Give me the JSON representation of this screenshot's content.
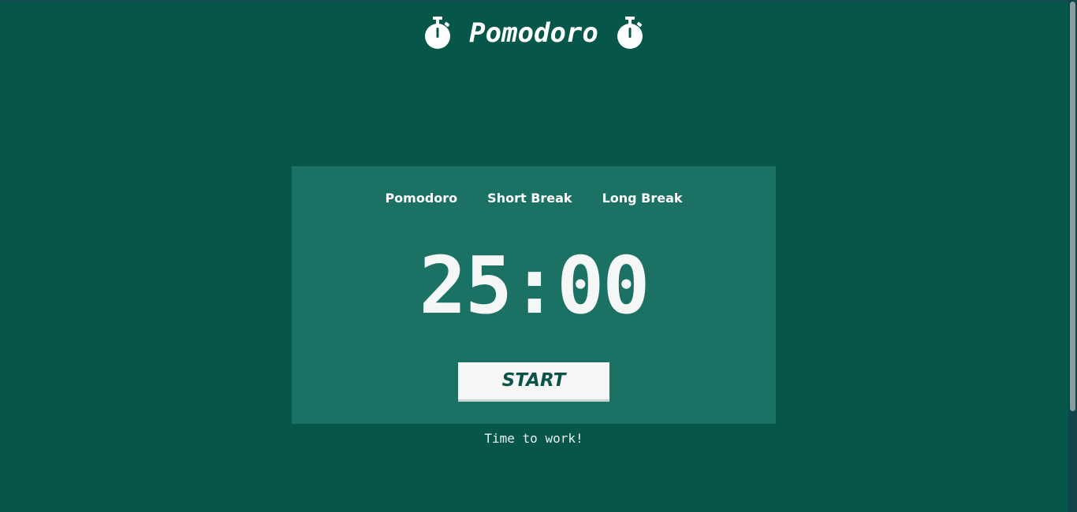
{
  "header": {
    "title": "Pomodoro",
    "left_icon": "stopwatch-icon",
    "right_icon": "stopwatch-icon"
  },
  "modes": [
    {
      "label": "Pomodoro"
    },
    {
      "label": "Short Break"
    },
    {
      "label": "Long Break"
    }
  ],
  "timer": {
    "display": "25:00"
  },
  "controls": {
    "start_label": "START"
  },
  "status": {
    "message": "Time to work!"
  },
  "colors": {
    "background": "#06564a",
    "panel": "#1b7163",
    "text": "#ffffff",
    "button_bg": "#f6f6f6",
    "button_text": "#0c5449"
  }
}
